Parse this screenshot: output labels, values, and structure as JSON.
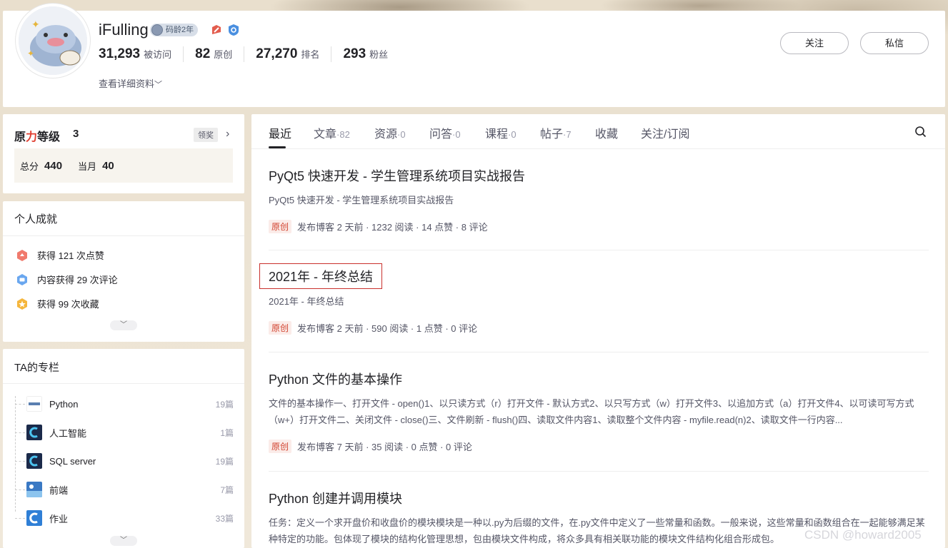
{
  "profile": {
    "nickname": "iFulling",
    "code_age": "码龄2年",
    "stats": [
      {
        "num": "31,293",
        "label": "被访问"
      },
      {
        "num": "82",
        "label": "原创"
      },
      {
        "num": "27,270",
        "label": "排名"
      },
      {
        "num": "293",
        "label": "粉丝"
      }
    ],
    "detail_link": "查看详细资料",
    "follow_label": "关注",
    "message_label": "私信"
  },
  "level": {
    "title_part1": "原",
    "title_part2": "力",
    "title_part3": "等级",
    "value": "3",
    "award_label": "领奖",
    "total_label": "总分",
    "total_value": "440",
    "month_label": "当月",
    "month_value": "40"
  },
  "achievements": {
    "title": "个人成就",
    "items": [
      {
        "text": "获得 121 次点赞",
        "icon": "like-badge-icon"
      },
      {
        "text": "内容获得 29 次评论",
        "icon": "comment-badge-icon"
      },
      {
        "text": "获得 99 次收藏",
        "icon": "star-badge-icon"
      }
    ]
  },
  "columns": {
    "title": "TA的专栏",
    "items": [
      {
        "name": "Python",
        "count": "19篇"
      },
      {
        "name": "人工智能",
        "count": "1篇"
      },
      {
        "name": "SQL server",
        "count": "19篇"
      },
      {
        "name": "前端",
        "count": "7篇"
      },
      {
        "name": "作业",
        "count": "33篇"
      }
    ]
  },
  "tabs": [
    {
      "label": "最近",
      "count": ""
    },
    {
      "label": "文章",
      "count": "·82"
    },
    {
      "label": "资源",
      "count": "·0"
    },
    {
      "label": "问答",
      "count": "·0"
    },
    {
      "label": "课程",
      "count": "·0"
    },
    {
      "label": "帖子",
      "count": "·7"
    },
    {
      "label": "收藏",
      "count": ""
    },
    {
      "label": "关注/订阅",
      "count": ""
    }
  ],
  "articles": [
    {
      "title": "PyQt5 快速开发 - 学生管理系统项目实战报告",
      "desc": "PyQt5 快速开发 - 学生管理系统项目实战报告",
      "orig": "原创",
      "meta": "发布博客 2 天前 ·  1232 阅读 ·  14 点赞 ·  8 评论"
    },
    {
      "title": "2021年 - 年终总结",
      "desc": "2021年 - 年终总结",
      "orig": "原创",
      "meta": "发布博客 2 天前 ·  590 阅读 ·  1 点赞 ·  0 评论"
    },
    {
      "title": "Python 文件的基本操作",
      "desc": "文件的基本操作一、打开文件 - open()1、以只读方式（r）打开文件 - 默认方式2、以只写方式（w）打开文件3、以追加方式（a）打开文件4、以可读可写方式（w+）打开文件二、关闭文件 - close()三、文件刷新 - flush()四、读取文件内容1、读取整个文件内容 - myfile.read(n)2、读取文件一行内容...",
      "orig": "原创",
      "meta": "发布博客 7 天前 ·  35 阅读 ·  0 点赞 ·  0 评论"
    },
    {
      "title": "Python 创建并调用模块",
      "desc": "任务：定义一个求开盘价和收盘价的模块模块是一种以.py为后缀的文件，在.py文件中定义了一些常量和函数。一般来说，这些常量和函数组合在一起能够满足某种特定的功能。包体现了模块的结构化管理思想，包由模块文件构成，将众多具有相关联功能的模块文件结构化组合形成包。"
    }
  ],
  "watermark": "CSDN @howard2005",
  "colors": {
    "accent_red": "#e03d2f",
    "text_main": "#222226",
    "text_muted": "#555666",
    "count_gray": "#999aaa"
  }
}
